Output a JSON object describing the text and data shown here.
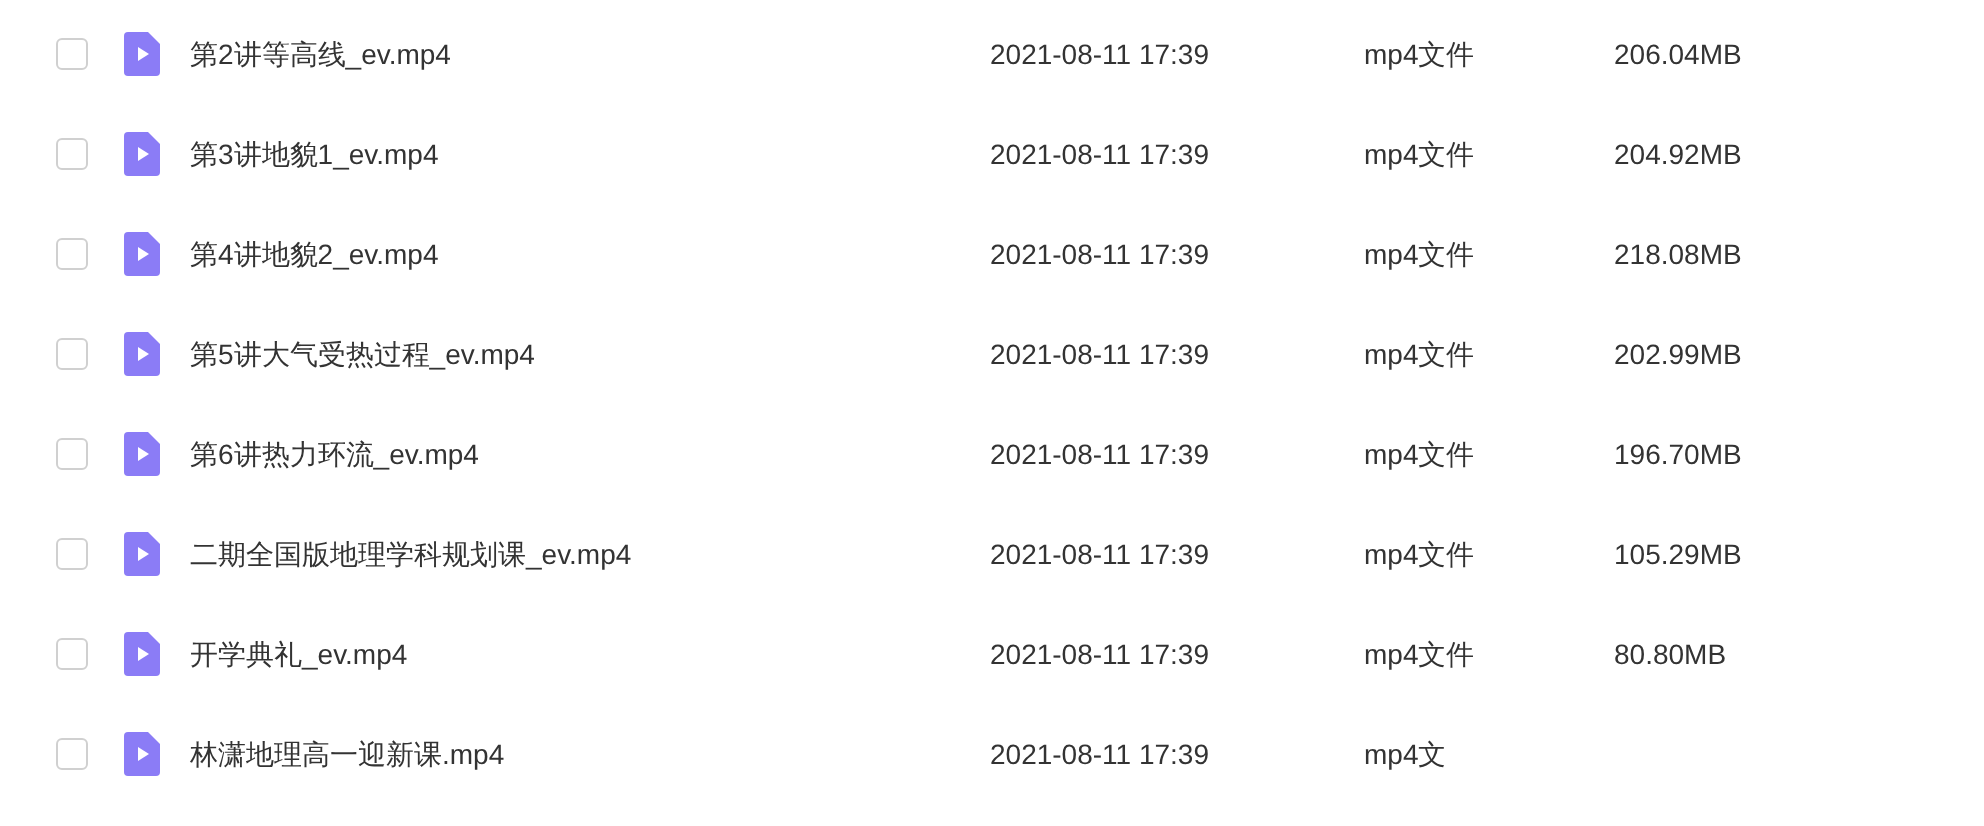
{
  "files": [
    {
      "name": "第2讲等高线_ev.mp4",
      "date": "2021-08-11 17:39",
      "type": "mp4文件",
      "size": "206.04MB",
      "selected": false
    },
    {
      "name": "第3讲地貌1_ev.mp4",
      "date": "2021-08-11 17:39",
      "type": "mp4文件",
      "size": "204.92MB",
      "selected": false
    },
    {
      "name": "第4讲地貌2_ev.mp4",
      "date": "2021-08-11 17:39",
      "type": "mp4文件",
      "size": "218.08MB",
      "selected": false
    },
    {
      "name": "第5讲大气受热过程_ev.mp4",
      "date": "2021-08-11 17:39",
      "type": "mp4文件",
      "size": "202.99MB",
      "selected": false
    },
    {
      "name": "第6讲热力环流_ev.mp4",
      "date": "2021-08-11 17:39",
      "type": "mp4文件",
      "size": "196.70MB",
      "selected": false
    },
    {
      "name": "二期全国版地理学科规划课_ev.mp4",
      "date": "2021-08-11 17:39",
      "type": "mp4文件",
      "size": "105.29MB",
      "selected": false
    },
    {
      "name": "开学典礼_ev.mp4",
      "date": "2021-08-11 17:39",
      "type": "mp4文件",
      "size": "80.80MB",
      "selected": false
    },
    {
      "name": "林潇地理高一迎新课.mp4",
      "date": "2021-08-11 17:39",
      "type": "mp4文",
      "selected": false
    }
  ]
}
